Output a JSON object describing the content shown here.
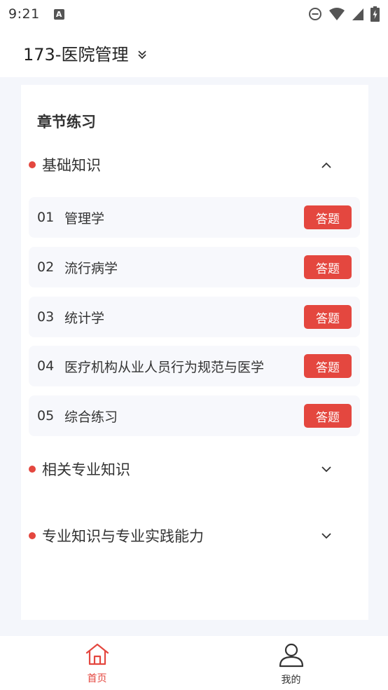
{
  "status_bar": {
    "time": "9:21",
    "app_icon_letter": "A",
    "icons": [
      "dnd-icon",
      "wifi-icon",
      "signal-icon",
      "battery-charging-icon"
    ]
  },
  "header": {
    "title": "173-医院管理",
    "dropdown_icon": "double-chevron-down-icon"
  },
  "card": {
    "title": "章节练习",
    "sections": [
      {
        "label": "基础知识",
        "expanded": true,
        "chapters": [
          {
            "num": "01",
            "name": "管理学",
            "button": "答题"
          },
          {
            "num": "02",
            "name": "流行病学",
            "button": "答题"
          },
          {
            "num": "03",
            "name": "统计学",
            "button": "答题"
          },
          {
            "num": "04",
            "name": "医疗机构从业人员行为规范与医学",
            "button": "答题"
          },
          {
            "num": "05",
            "name": "综合练习",
            "button": "答题"
          }
        ]
      },
      {
        "label": "相关专业知识",
        "expanded": false
      },
      {
        "label": "专业知识与专业实践能力",
        "expanded": false
      }
    ]
  },
  "bottom_nav": {
    "items": [
      {
        "label": "首页",
        "icon": "home-icon",
        "active": true
      },
      {
        "label": "我的",
        "icon": "user-icon",
        "active": false
      }
    ]
  },
  "colors": {
    "accent": "#e4473f",
    "background": "#f4f6fb",
    "row_background": "#f7f8fc",
    "text": "#333333"
  }
}
